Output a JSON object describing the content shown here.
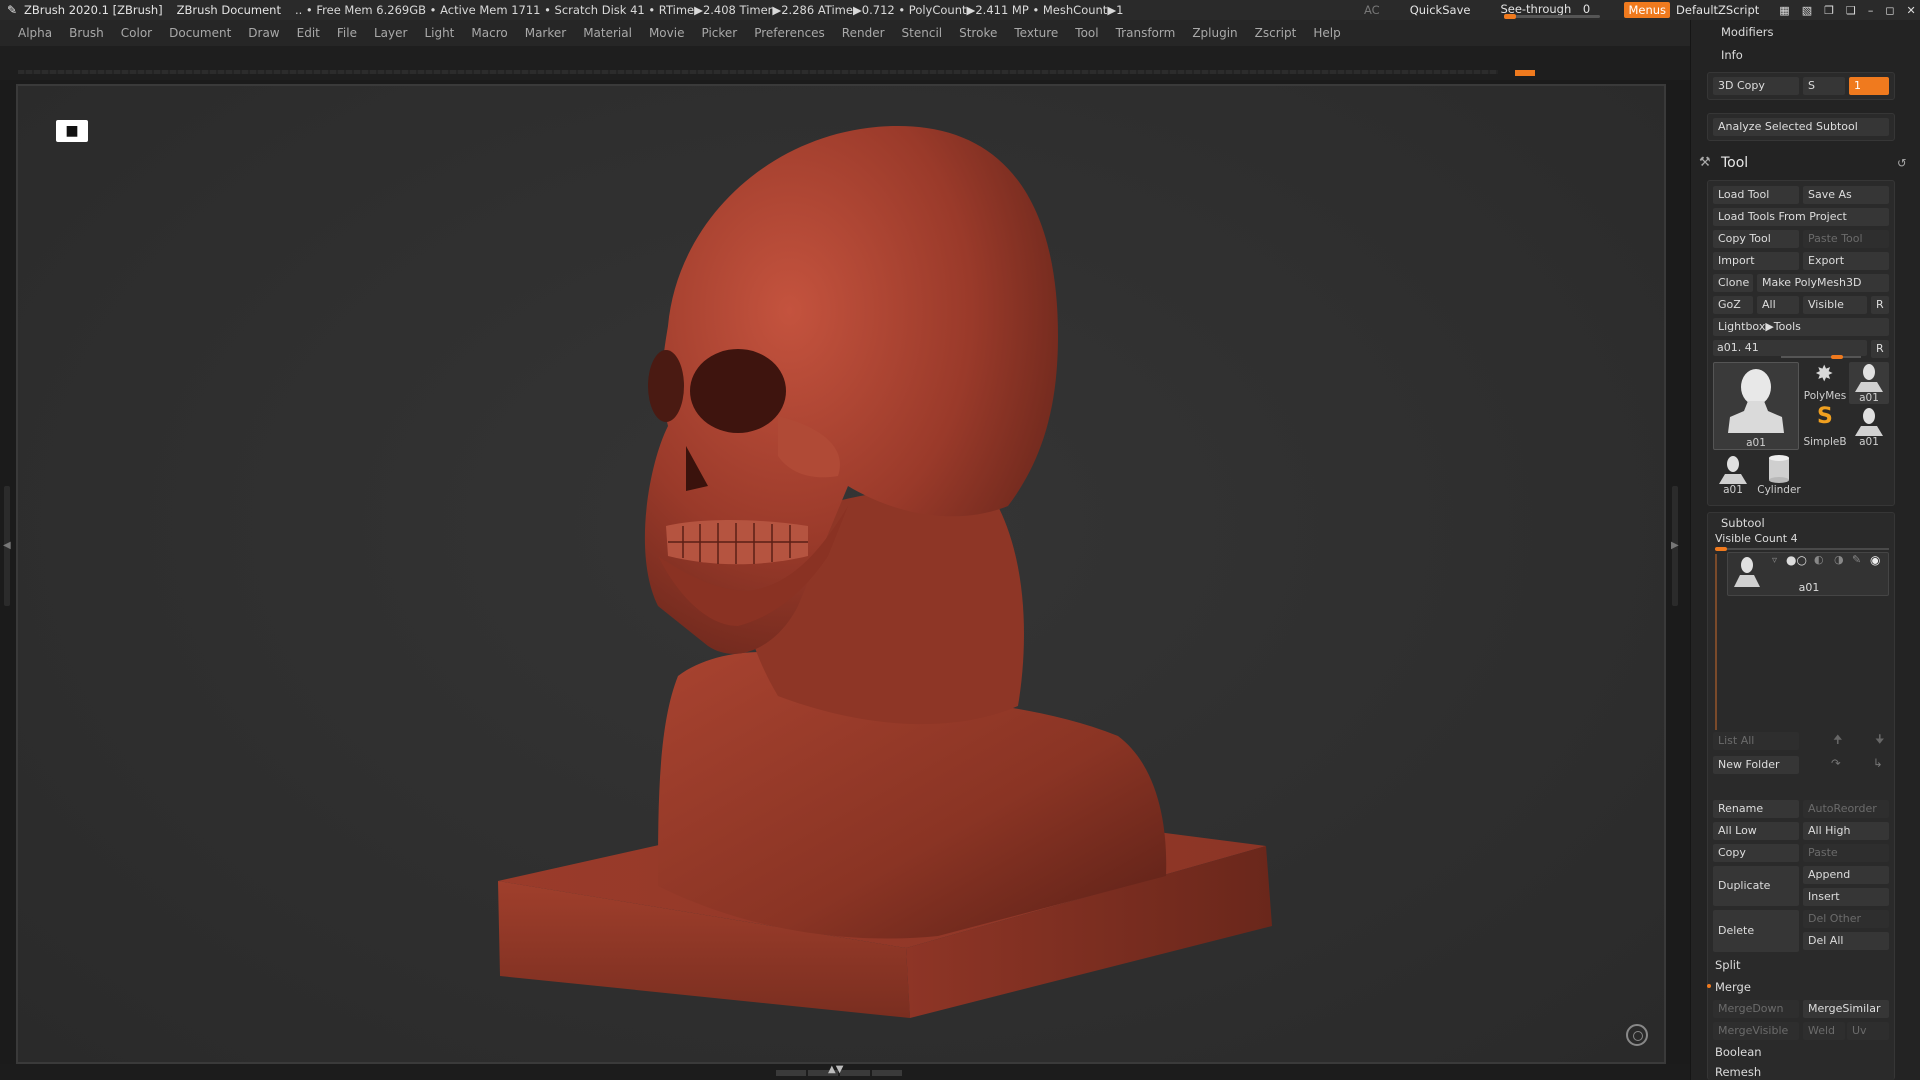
{
  "titlebar": {
    "app": "ZBrush 2020.1 [ZBrush]",
    "document": "ZBrush Document",
    "stats": "..  • Free Mem 6.269GB • Active Mem 1711 • Scratch Disk 41 •  RTime▶2.408 Timer▶2.286 ATime▶0.712 • PolyCount▶2.411 MP  • MeshCount▶1",
    "ac": "AC",
    "quicksave": "QuickSave",
    "see_through_label": "See-through",
    "see_through_value": "0",
    "menus": "Menus",
    "default_zscript": "DefaultZScript"
  },
  "menu": [
    "Alpha",
    "Brush",
    "Color",
    "Document",
    "Draw",
    "Edit",
    "File",
    "Layer",
    "Light",
    "Macro",
    "Marker",
    "Material",
    "Movie",
    "Picker",
    "Preferences",
    "Render",
    "Stencil",
    "Stroke",
    "Texture",
    "Tool",
    "Transform",
    "Zplugin",
    "Zscript",
    "Help"
  ],
  "panel": {
    "modifiers": "Modifiers",
    "info": "Info",
    "copy3d": "3D Copy",
    "copy3d_s": "S",
    "copy3d_value": "1",
    "analyze": "Analyze Selected Subtool",
    "tool_title": "Tool",
    "load_tool": "Load Tool",
    "save_as": "Save As",
    "load_tools_from_project": "Load Tools From Project",
    "copy_tool": "Copy Tool",
    "paste_tool": "Paste Tool",
    "import": "Import",
    "export": "Export",
    "clone": "Clone",
    "make_polymesh": "Make PolyMesh3D",
    "goz": "GoZ",
    "all": "All",
    "visible": "Visible",
    "r": "R",
    "lightbox_tools": "Lightbox▶Tools",
    "current_tool": "a01. 41",
    "thumbs": {
      "main": "a01",
      "polymesh": "PolyMes",
      "a01_small1": "a01",
      "simpleb": "SimpleB",
      "a01_small2": "a01",
      "a01_small3": "a01",
      "cylinder": "Cylinder"
    },
    "subtool_title": "Subtool",
    "visible_count": "Visible Count 4",
    "subtool_item": "a01",
    "list_all": "List All",
    "new_folder": "New Folder",
    "rename": "Rename",
    "auto_reorder": "AutoReorder",
    "all_low": "All Low",
    "all_high": "All High",
    "copy": "Copy",
    "paste": "Paste",
    "duplicate": "Duplicate",
    "append": "Append",
    "insert": "Insert",
    "delete": "Delete",
    "del_other": "Del Other",
    "del_all": "Del All",
    "split": "Split",
    "merge": "Merge",
    "merge_down": "MergeDown",
    "merge_similar": "MergeSimilar",
    "merge_visible": "MergeVisible",
    "weld": "Weld",
    "uv": "Uv",
    "boolean": "Boolean",
    "remesh": "Remesh"
  }
}
